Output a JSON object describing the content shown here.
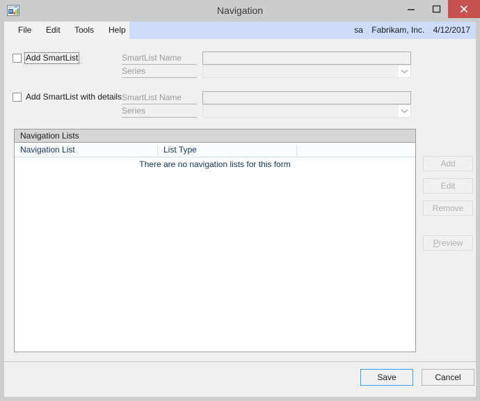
{
  "window": {
    "title": "Navigation",
    "app_icon": "window-chart-icon",
    "controls": {
      "minimize": "minimize-icon",
      "maximize": "maximize-icon",
      "close": "close-icon"
    },
    "close_color": "#c75050",
    "titlebar_color": "#cccccc"
  },
  "menubar": {
    "items": [
      {
        "label": "File"
      },
      {
        "label": "Edit"
      },
      {
        "label": "Tools"
      },
      {
        "label": "Help"
      }
    ],
    "strip_color": "#ccdcf7"
  },
  "status": {
    "user": "sa",
    "company": "Fabrikam, Inc.",
    "date": "4/12/2017"
  },
  "form": {
    "rows": [
      {
        "checkbox_label": "Add SmartList",
        "checked": false,
        "focused": true,
        "name_prompt": "SmartList Name",
        "name_value": "",
        "series_prompt": "Series",
        "series_value": ""
      },
      {
        "checkbox_label": "Add SmartList with details",
        "checked": false,
        "focused": false,
        "name_prompt": "SmartList Name",
        "name_value": "",
        "series_prompt": "Series",
        "series_value": ""
      }
    ]
  },
  "navigation_lists": {
    "caption": "Navigation Lists",
    "columns": [
      "Navigation List",
      "List Type",
      ""
    ],
    "rows": [],
    "empty_message": "There are no navigation lists for this form"
  },
  "side_buttons": [
    {
      "label": "Add",
      "enabled": false
    },
    {
      "label": "Edit",
      "enabled": false
    },
    {
      "label": "Remove",
      "enabled": false
    },
    {
      "label": "Preview",
      "enabled": false,
      "accelerator": "P"
    }
  ],
  "footer": {
    "save_label": "Save",
    "cancel_label": "Cancel",
    "default_button": "Save",
    "focus_color": "#3a9ae8"
  }
}
